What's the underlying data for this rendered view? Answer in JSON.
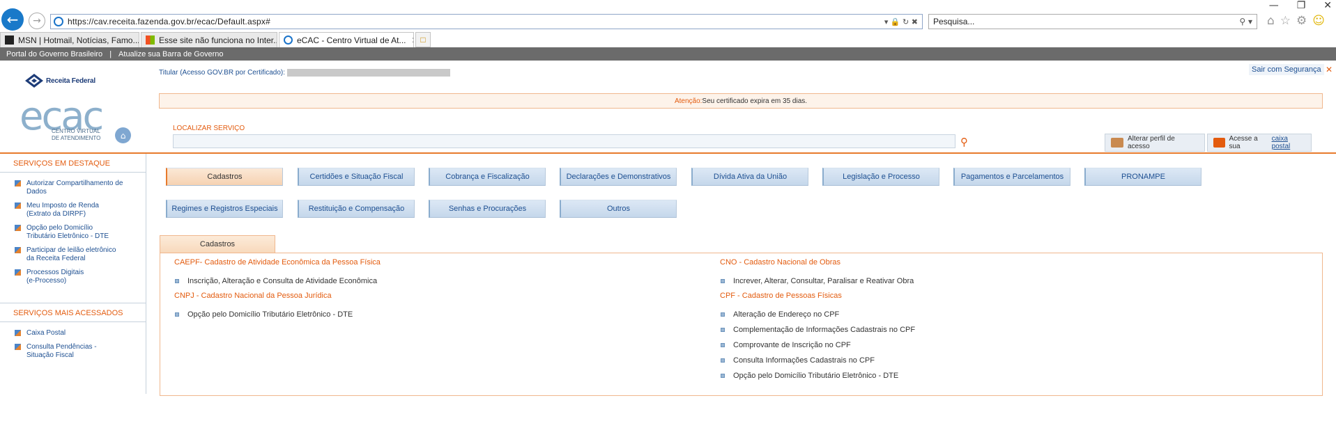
{
  "browser": {
    "url": "https://cav.receita.fazenda.gov.br/ecac/Default.aspx#",
    "search_placeholder": "Pesquisa...",
    "tabs": [
      {
        "label": "MSN | Hotmail, Notícias, Famo...",
        "active": false
      },
      {
        "label": "Esse site não funciona no Inter...",
        "active": false
      },
      {
        "label": "eCAC - Centro Virtual de At...",
        "active": true
      }
    ]
  },
  "gov_bar": {
    "portal": "Portal do Governo Brasileiro",
    "separator": "|",
    "update": "Atualize sua Barra de Governo"
  },
  "header": {
    "rf_logo_text": "Receita Federal",
    "ecac_big": "ecac",
    "ecac_sub_1": "CENTRO VIRTUAL",
    "ecac_sub_2": "DE ATENDIMENTO",
    "titular_label": "Titular (Acesso GOV.BR por Certificado):",
    "sair_label": "Sair com Segurança",
    "alert_label": "Atenção:",
    "alert_text": "Seu certificado expira em 35 dias.",
    "localizar_label": "LOCALIZAR SERVIÇO",
    "alterar_perfil": "Alterar perfil de acesso",
    "caixa_prefix": "Acesse a sua",
    "caixa_link": "caixa postal"
  },
  "sidebar": {
    "destaque_title": "SERVIÇOS EM DESTAQUE",
    "destaque_items": [
      "Autorizar Compartilhamento de\nDados",
      "Meu Imposto de Renda\n(Extrato da DIRPF)",
      "Opção pelo Domicílio\nTributário Eletrônico - DTE",
      "Participar de leilão eletrônico\nda Receita Federal",
      "Processos Digitais\n(e-Processo)"
    ],
    "acessados_title": "SERVIÇOS MAIS ACESSADOS",
    "acessados_items": [
      "Caixa Postal",
      "Consulta Pendências -\nSituação Fiscal"
    ]
  },
  "categories": [
    "Cadastros",
    "Certidões e Situação Fiscal",
    "Cobrança e Fiscalização",
    "Declarações e Demonstrativos",
    "Dívida Ativa da União",
    "Legislação e Processo",
    "Pagamentos e Parcelamentos",
    "PRONAMPE",
    "Regimes e Registros Especiais",
    "Restituição e Compensação",
    "Senhas e Procurações",
    "Outros"
  ],
  "section": {
    "tab_label": "Cadastros",
    "left_groups": [
      {
        "title": "CAEPF- Cadastro de Atividade Econômica da Pessoa Física",
        "items": [
          "Inscrição, Alteração e Consulta de Atividade Econômica"
        ]
      },
      {
        "title": "CNPJ - Cadastro Nacional da Pessoa Jurídica",
        "items": [
          "Opção pelo Domicílio Tributário Eletrônico - DTE"
        ]
      }
    ],
    "right_groups": [
      {
        "title": "CNO - Cadastro Nacional de Obras",
        "items": [
          "Increver, Alterar, Consultar, Paralisar e Reativar Obra"
        ]
      },
      {
        "title": "CPF - Cadastro de Pessoas Físicas",
        "items": [
          "Alteração de Endereço no CPF",
          "Complementação de Informações Cadastrais no CPF",
          "Comprovante de Inscrição no CPF",
          "Consulta Informações Cadastrais no CPF",
          "Opção pelo Domicílio Tributário Eletrônico - DTE"
        ]
      }
    ]
  },
  "colors": {
    "accent": "#e35b0e",
    "link": "#1d4f91",
    "govbar": "#6b6b6b"
  }
}
